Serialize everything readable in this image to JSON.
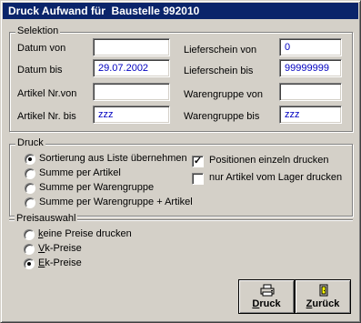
{
  "window": {
    "title": "Druck Aufwand für  Baustelle 992010"
  },
  "selektion": {
    "legend": "Selektion",
    "datum_von": {
      "label": "Datum von",
      "value": ""
    },
    "datum_bis": {
      "label": "Datum bis",
      "value": "29.07.2002"
    },
    "artikel_von": {
      "label": "Artikel Nr.von",
      "value": ""
    },
    "artikel_bis": {
      "label": "Artikel Nr. bis",
      "value": "zzz"
    },
    "lieferschein_von": {
      "label": "Lieferschein von",
      "value": "0"
    },
    "lieferschein_bis": {
      "label": "Lieferschein bis",
      "value": "99999999"
    },
    "warengruppe_von": {
      "label": "Warengruppe von",
      "value": ""
    },
    "warengruppe_bis": {
      "label": "Warengruppe bis",
      "value": "zzz"
    }
  },
  "druck": {
    "legend": "Druck",
    "options": [
      {
        "label": "Sortierung aus Liste übernehmen",
        "selected": true
      },
      {
        "label": "Summe per  Artikel",
        "selected": false
      },
      {
        "label": "Summe per Warengruppe",
        "selected": false
      },
      {
        "label": "Summe per Warengruppe + Artikel",
        "selected": false
      }
    ],
    "checks": [
      {
        "label": "Positionen einzeln drucken",
        "checked": true
      },
      {
        "label": "nur Artikel vom Lager drucken",
        "checked": false
      }
    ]
  },
  "preisauswahl": {
    "legend": "Preisauswahl",
    "options": [
      {
        "label_first": "k",
        "label_rest": "eine Preise drucken",
        "selected": false
      },
      {
        "label_first": "V",
        "label_rest": "k-Preise",
        "selected": false
      },
      {
        "label_first": "E",
        "label_rest": "k-Preise",
        "selected": true
      }
    ]
  },
  "buttons": {
    "druck": {
      "label_first": "D",
      "label_rest": "ruck",
      "icon": "printer-icon"
    },
    "zurueck": {
      "label_first": "Z",
      "label_rest": "urück",
      "icon": "door-exit-icon"
    }
  },
  "colors": {
    "titlebar": "#0a246a",
    "field_text": "#0000c0",
    "window": "#d4d0c8"
  }
}
